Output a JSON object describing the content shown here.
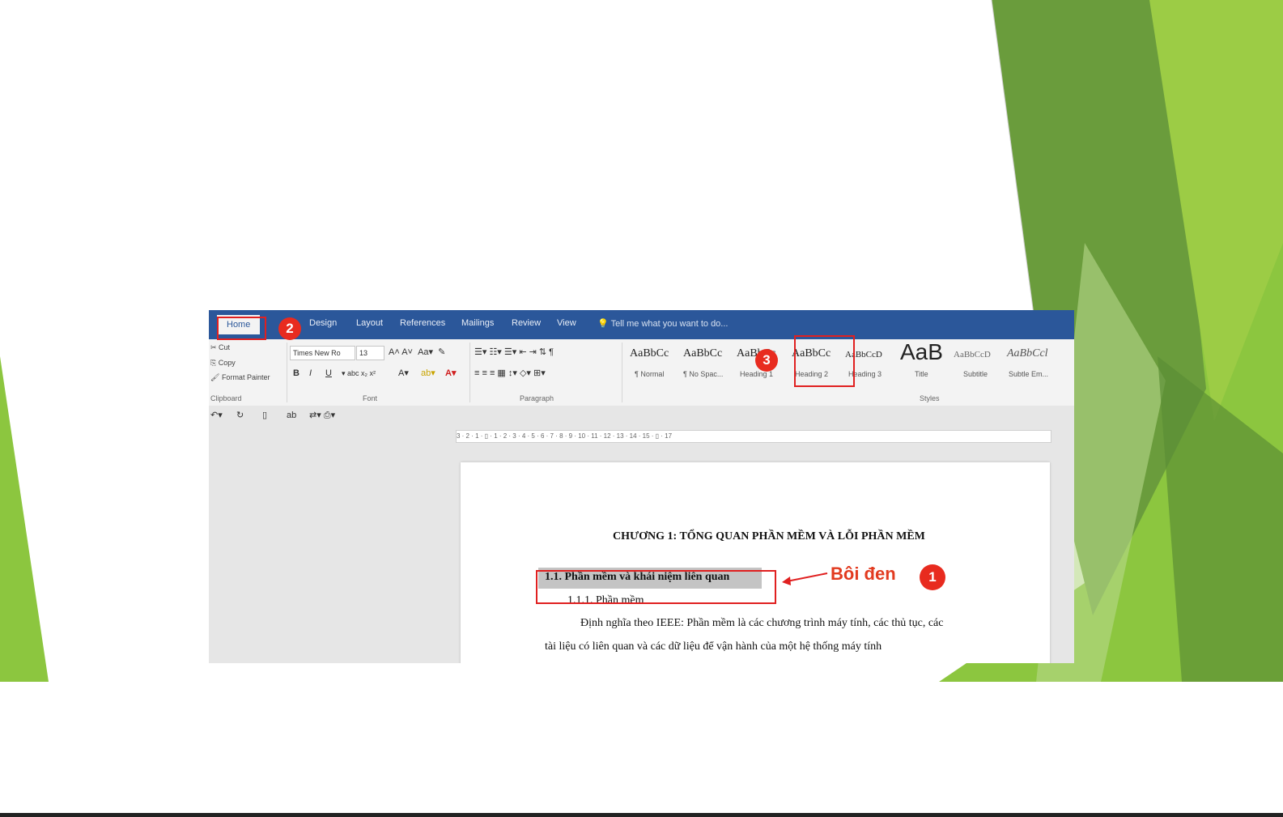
{
  "colors": {
    "green_dark": "#5e8f3a",
    "green_mid": "#78ad3b",
    "green_light": "#9ac53d",
    "accent": "#e02020",
    "word_blue": "#2b579a"
  },
  "ribbon": {
    "tabs": [
      "Home",
      "Design",
      "Layout",
      "References",
      "Mailings",
      "Review",
      "View"
    ],
    "tell_me": "Tell me what you want to do...",
    "clipboard": {
      "cut": "Cut",
      "copy": "Copy",
      "format_painter": "Format Painter",
      "group": "Clipboard"
    },
    "font": {
      "name": "Times New Ro",
      "size": "13",
      "group": "Font"
    },
    "paragraph": {
      "group": "Paragraph"
    },
    "styles": {
      "group": "Styles",
      "items": [
        {
          "preview": "AaBbCc",
          "name": "¶ Normal"
        },
        {
          "preview": "AaBbCc",
          "name": "¶ No Spac..."
        },
        {
          "preview": "AaBbCc",
          "name": "Heading 1"
        },
        {
          "preview": "AaBbCc",
          "name": "Heading 2"
        },
        {
          "preview": "AaBbCcD",
          "name": "Heading 3"
        },
        {
          "preview": "AaB",
          "name": "Title"
        },
        {
          "preview": "AaBbCcD",
          "name": "Subtitle"
        },
        {
          "preview": "AaBbCcl",
          "name": "Subtle Em..."
        }
      ]
    }
  },
  "ruler": {
    "marks": "3 · 2 · 1 · ▯ · 1 · 2 · 3 · 4 · 5 · 6 · 7 · 8 · 9 · 10 · 11 · 12 · 13 · 14 · 15 · ▯ · 17"
  },
  "document": {
    "chapter_title": "CHƯƠNG 1: TỔNG QUAN PHẦN MỀM VÀ LỖI PHẦN MỀM",
    "heading": "1.1. Phần mềm và khái niệm liên quan",
    "subheading": "1.1.1. Phần mềm",
    "para1": "Định nghĩa theo IEEE: Phần mềm là các chương trình máy tính, các thủ tục, các",
    "para2": "tài liệu có liên quan và các dữ liệu để vận hành của một hệ thống máy tính"
  },
  "annotations": {
    "callout": "Bôi đen",
    "badge1": "1",
    "badge2": "2",
    "badge3": "3"
  }
}
